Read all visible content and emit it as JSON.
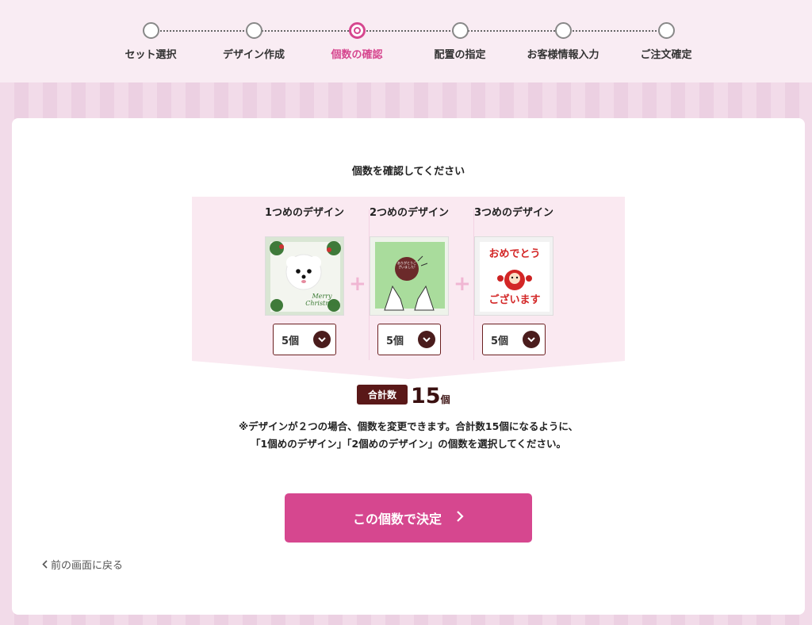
{
  "stepper": {
    "steps": [
      {
        "label": "セット選択",
        "state": "done"
      },
      {
        "label": "デザイン作成",
        "state": "done"
      },
      {
        "label": "個数の確認",
        "state": "current"
      },
      {
        "label": "配置の指定",
        "state": "todo"
      },
      {
        "label": "お客様情報入力",
        "state": "todo"
      },
      {
        "label": "ご注文確定",
        "state": "todo"
      }
    ]
  },
  "main": {
    "title": "個数を確認してください",
    "designs": [
      {
        "label": "1つめのデザイン",
        "quantity": "5個",
        "image_text": "Merry Christmas"
      },
      {
        "label": "2つめのデザイン",
        "quantity": "5個",
        "image_text": "ありがとうございました!"
      },
      {
        "label": "3つめのデザイン",
        "quantity": "5個",
        "image_text_top": "おめでとう",
        "image_text_bottom": "ございます"
      }
    ],
    "plus_sign": "+",
    "total": {
      "label": "合計数",
      "value": "15",
      "unit": "個"
    },
    "note_line1": "※デザインが２つの場合、個数を変更できます。合計数15個になるように、",
    "note_line2": "「1個めのデザイン」「2個めのデザイン」の個数を選択してください。",
    "decide_button": "この個数で決定",
    "back_link": "前の画面に戻る"
  },
  "colors": {
    "accent": "#d6478f",
    "dark_brown": "#5a1818",
    "panel_pink": "#fae9f1"
  }
}
